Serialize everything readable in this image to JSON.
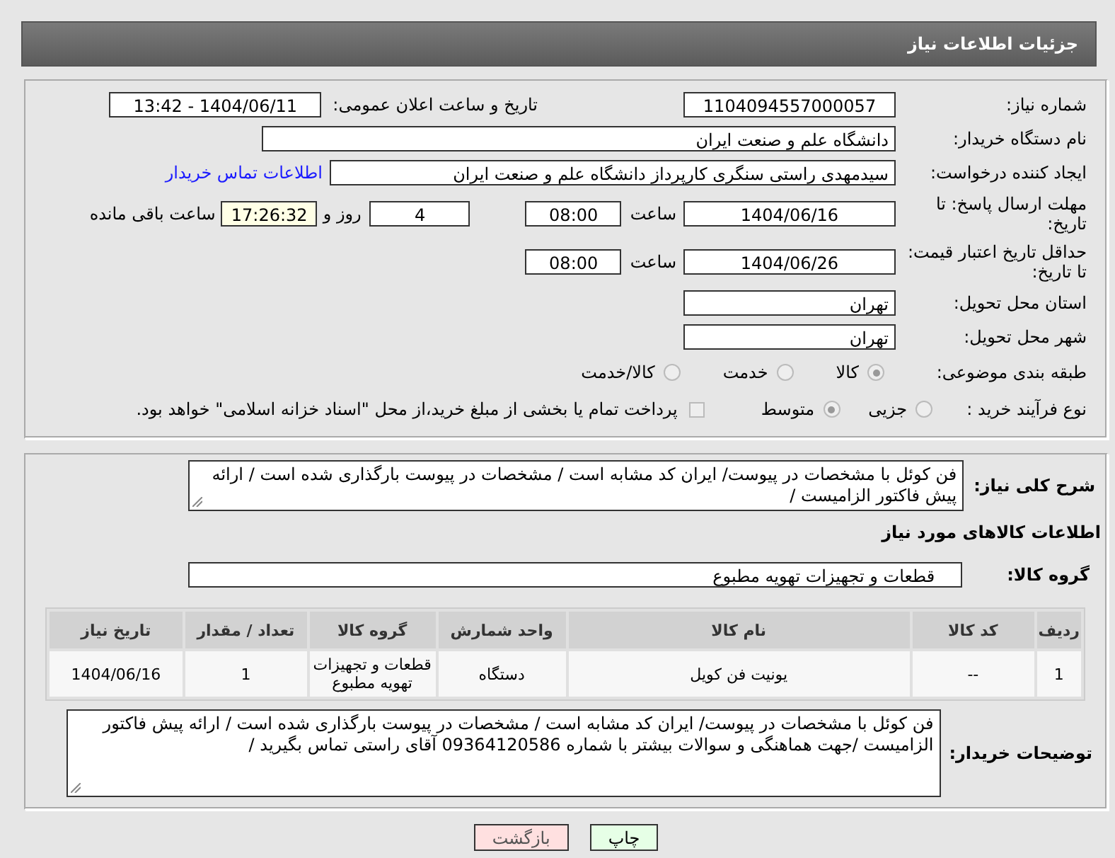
{
  "header": {
    "title": "جزئیات اطلاعات نیاز"
  },
  "need_number": {
    "label": "شماره نیاز:",
    "value": "1104094557000057"
  },
  "announce": {
    "label": "تاریخ و ساعت اعلان عمومی:",
    "value": "1404/06/11 - 13:42"
  },
  "buyer_org": {
    "label": "نام دستگاه خریدار:",
    "value": "دانشگاه علم و صنعت ایران"
  },
  "requester": {
    "label": "ایجاد کننده درخواست:",
    "value": "سیدمهدی راستی سنگری کارپرداز دانشگاه علم و صنعت ایران",
    "link": "اطلاعات تماس خریدار"
  },
  "reply_deadline": {
    "label": "مهلت ارسال پاسخ: تا تاریخ:",
    "date": "1404/06/16",
    "time_label": "ساعت",
    "time": "08:00",
    "days": "4",
    "days_suffix": "روز و",
    "remaining": "17:26:32",
    "remaining_suffix": "ساعت باقی مانده"
  },
  "price_validity": {
    "label": "حداقل تاریخ اعتبار قیمت: تا تاریخ:",
    "date": "1404/06/26",
    "time_label": "ساعت",
    "time": "08:00"
  },
  "province": {
    "label": "استان محل تحویل:",
    "value": "تهران"
  },
  "city": {
    "label": "شهر محل تحویل:",
    "value": "تهران"
  },
  "category": {
    "label": "طبقه بندی موضوعی:",
    "options": [
      {
        "label": "کالا",
        "selected": true
      },
      {
        "label": "خدمت",
        "selected": false
      },
      {
        "label": "کالا/خدمت",
        "selected": false
      }
    ]
  },
  "purchase_type": {
    "label": "نوع فرآیند خرید :",
    "options": [
      {
        "label": "جزیی",
        "selected": false
      },
      {
        "label": "متوسط",
        "selected": true
      }
    ],
    "payment_note": {
      "label": "پرداخت تمام یا بخشی از مبلغ خرید،از محل \"اسناد خزانه اسلامی\" خواهد بود.",
      "checked": false
    }
  },
  "description": {
    "label": "شرح کلی نیاز:",
    "value": "فن کوئل با مشخصات در پیوست/ ایران کد مشابه است / مشخصات در پیوست بارگذاری شده است / ارائه پیش فاکتور الزامیست /"
  },
  "goods_title": "اطلاعات کالاهای مورد نیاز",
  "goods_group": {
    "label": "گروه کالا:",
    "value": "قطعات و تجهیزات تهویه مطبوع"
  },
  "table": {
    "columns": [
      "ردیف",
      "کد کالا",
      "نام کالا",
      "واحد شمارش",
      "گروه کالا",
      "تعداد / مقدار",
      "تاریخ نیاز"
    ],
    "rows": [
      [
        "1",
        "--",
        "یونیت فن کویل",
        "دستگاه",
        "قطعات و تجهیزات تهویه مطبوع",
        "1",
        "1404/06/16"
      ]
    ]
  },
  "buyer_notes": {
    "label": "توضیحات خریدار:",
    "value": "فن کوئل با مشخصات در پیوست/ ایران کد مشابه است / مشخصات در پیوست بارگذاری شده است / ارائه پیش فاکتور الزامیست /جهت هماهنگی و سوالات بیشتر با شماره 09364120586 آقای راستی تماس بگیرید /"
  },
  "buttons": [
    {
      "label": "چاپ",
      "kind": "print"
    },
    {
      "label": "بازگشت",
      "kind": "back"
    }
  ]
}
